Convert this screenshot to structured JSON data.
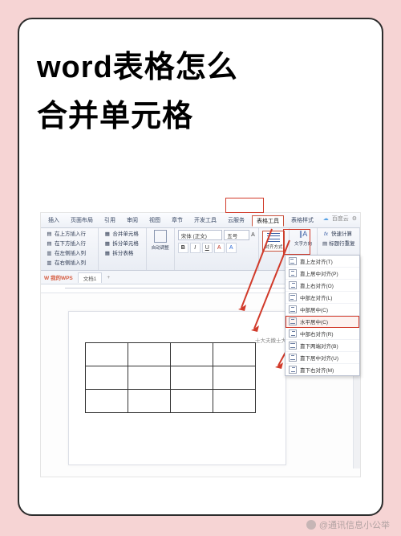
{
  "title": {
    "line1": "word表格怎么",
    "line2": "合并单元格"
  },
  "ribbon_tabs": {
    "items": [
      "插入",
      "页面布局",
      "引用",
      "审阅",
      "视图",
      "章节",
      "开发工具",
      "云服务",
      "表格工具",
      "表格样式"
    ],
    "active_index": 8,
    "cloud_tip": "百度云",
    "settings": ""
  },
  "ribbon": {
    "insert_group": {
      "above": "在上方插入行",
      "below": "在下方插入行",
      "left": "在左侧插入列",
      "right": "在右侧插入列"
    },
    "merge_group": {
      "merge": "合并单元格",
      "split": "拆分单元格",
      "split_table": "拆分表格"
    },
    "adjust": "自动调整",
    "font": {
      "name": "宋体 (正文)",
      "size": "五号"
    },
    "format_buttons": [
      "B",
      "I",
      "U",
      "A",
      "A"
    ],
    "align": {
      "label": "对齐方式"
    },
    "text_dir": "文字方向",
    "fx": "fx",
    "quick_calc": "快速计算",
    "title_repeat": "标题行重复"
  },
  "dropdown": {
    "items": [
      {
        "label": "靠上左对齐(T)"
      },
      {
        "label": "靠上居中对齐(P)"
      },
      {
        "label": "靠上右对齐(O)"
      },
      {
        "label": "中部左对齐(L)"
      },
      {
        "label": "中部居中(C)"
      },
      {
        "label": "水平居中(C)",
        "hl": true
      },
      {
        "label": "中部右对齐(R)"
      },
      {
        "label": "靠下两端对齐(B)"
      },
      {
        "label": "靠下居中对齐(U)"
      },
      {
        "label": "靠下右对齐(M)"
      }
    ]
  },
  "doc_tabs": {
    "wps": "W 我的WPS",
    "doc": "文档1",
    "plus": "+"
  },
  "caption": "士大夫撒士大夫",
  "watermark": "@通讯信息小公举"
}
